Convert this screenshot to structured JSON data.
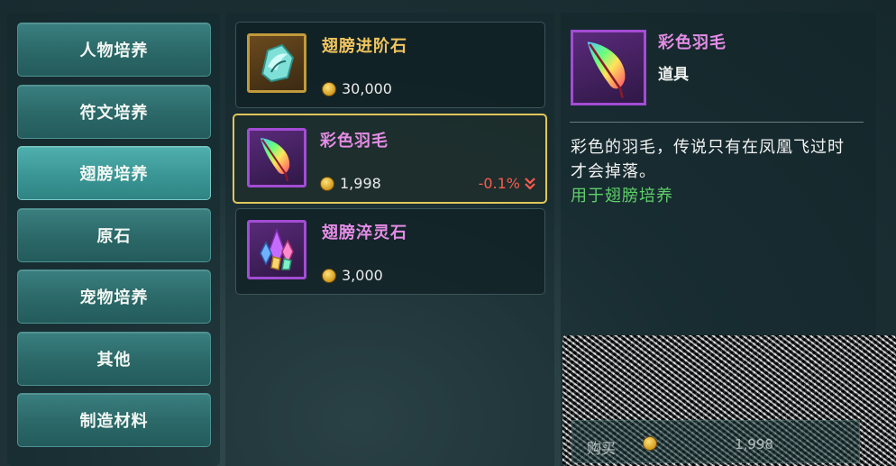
{
  "categories": [
    {
      "label": "人物培养",
      "active": false
    },
    {
      "label": "符文培养",
      "active": false
    },
    {
      "label": "翅膀培养",
      "active": true
    },
    {
      "label": "原石",
      "active": false
    },
    {
      "label": "宠物培养",
      "active": false
    },
    {
      "label": "其他",
      "active": false
    },
    {
      "label": "制造材料",
      "active": false
    }
  ],
  "items": [
    {
      "name": "翅膀进阶石",
      "name_color": "#f1c55d",
      "price": "30,000",
      "icon": "wing-stone-icon",
      "selected": false
    },
    {
      "name": "彩色羽毛",
      "name_color": "#e58ce6",
      "price": "1,998",
      "change": "-0.1%",
      "icon": "rainbow-feather-icon",
      "selected": true
    },
    {
      "name": "翅膀淬灵石",
      "name_color": "#e58ce6",
      "price": "3,000",
      "icon": "crystal-cluster-icon",
      "selected": false
    }
  ],
  "detail": {
    "name": "彩色羽毛",
    "type": "道具",
    "description": "彩色的羽毛，传说只有在凤凰飞过时才会掉落。",
    "usage": "用于翅膀培养",
    "icon": "rainbow-feather-icon"
  },
  "buy": {
    "label": "购买",
    "price": "1,998"
  },
  "colors": {
    "accent_gold": "#e1c65a",
    "price_drop": "#ff5a4e",
    "usage_green": "#5fcf6a",
    "rare_purple": "#a34cd4"
  }
}
